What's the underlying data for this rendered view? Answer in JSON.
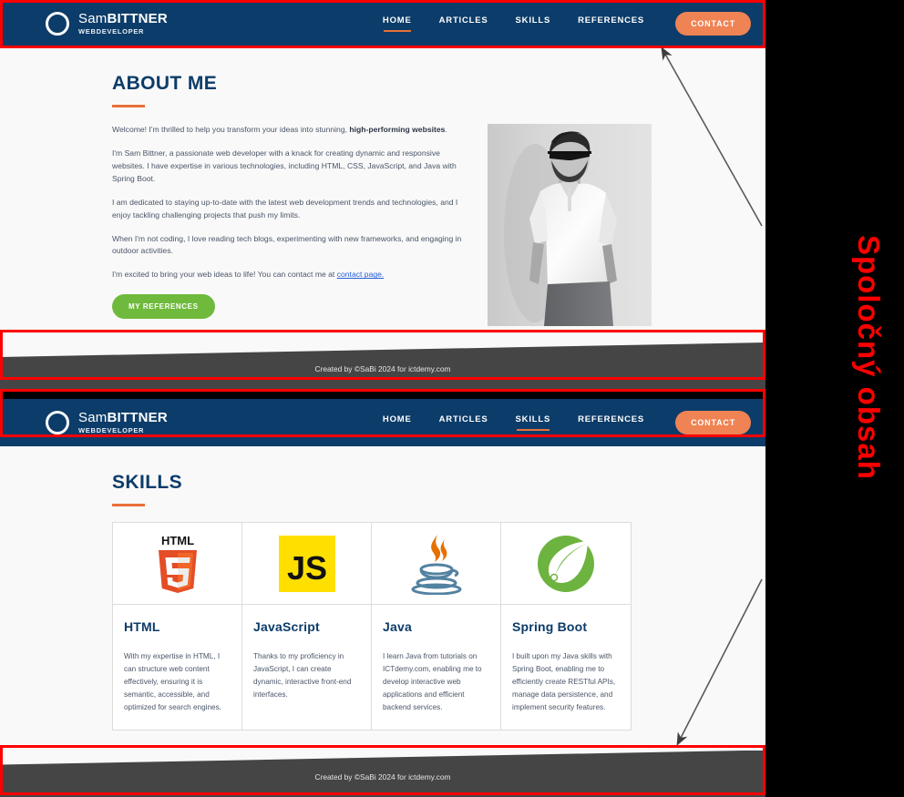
{
  "annotation": {
    "label": "Spoločný obsah",
    "color": "#ff0000"
  },
  "brand": {
    "name_light": "Sam",
    "name_bold": "BITTNER",
    "subtitle": "WEBDEVELOPER",
    "logo_icon": "circle-outline-icon"
  },
  "nav": {
    "items": [
      {
        "label": "HOME"
      },
      {
        "label": "ARTICLES"
      },
      {
        "label": "SKILLS"
      },
      {
        "label": "REFERENCES"
      }
    ],
    "cta_label": "CONTACT"
  },
  "page_home": {
    "active_nav": "HOME",
    "title": "ABOUT ME",
    "paragraphs": [
      {
        "text_before": "Welcome! I'm thrilled to help you transform your ideas into stunning, ",
        "bold": "high-performing websites",
        "text_after": "."
      },
      {
        "text_before": "I'm Sam Bittner, a passionate web developer with a knack for creating dynamic and responsive websites. I have expertise in various technologies, including HTML, CSS, JavaScript, and Java with Spring Boot.",
        "bold": "",
        "text_after": ""
      },
      {
        "text_before": "I am dedicated to staying up-to-date with the latest web development trends and technologies, and I enjoy tackling challenging projects that push my limits.",
        "bold": "",
        "text_after": ""
      },
      {
        "text_before": "When I'm not coding, I love reading tech blogs, experimenting with new frameworks, and engaging in outdoor activities.",
        "bold": "",
        "text_after": ""
      }
    ],
    "contact_line_before": "I'm excited to bring your web ideas to life! You can contact me at ",
    "contact_link": "contact page.",
    "references_button": "MY REFERENCES",
    "portrait_alt": "portrait-photo"
  },
  "page_skills": {
    "active_nav": "SKILLS",
    "title": "SKILLS",
    "cards": [
      {
        "icon": "html5-logo-icon",
        "name": "HTML",
        "desc": "With my expertise in HTML, I can structure web content effectively, ensuring it is semantic, accessible, and optimized for search engines."
      },
      {
        "icon": "javascript-logo-icon",
        "name": "JavaScript",
        "desc": "Thanks to my proficiency in JavaScript, I can create dynamic, interactive front-end interfaces."
      },
      {
        "icon": "java-logo-icon",
        "name": "Java",
        "desc": "I learn Java from tutorials on ICTdemy.com, enabling me to develop interactive web applications and efficient backend services."
      },
      {
        "icon": "spring-boot-logo-icon",
        "name": "Spring Boot",
        "desc": "I built upon my Java skills with Spring Boot, enabling me to efficiently create RESTful APIs, manage data persistence, and implement security features."
      }
    ]
  },
  "footer": {
    "text": "Created by ©SaBi 2024 for ictdemy.com"
  },
  "colors": {
    "header_navy": "#0c3c69",
    "accent_orange": "#ef8354",
    "underline_orange": "#e8703a",
    "button_green": "#6fba3c",
    "footer_gray": "#454546",
    "page_bg": "#f9f9f9",
    "annotation_red": "#ff0000",
    "link_blue": "#2b5fd9"
  }
}
